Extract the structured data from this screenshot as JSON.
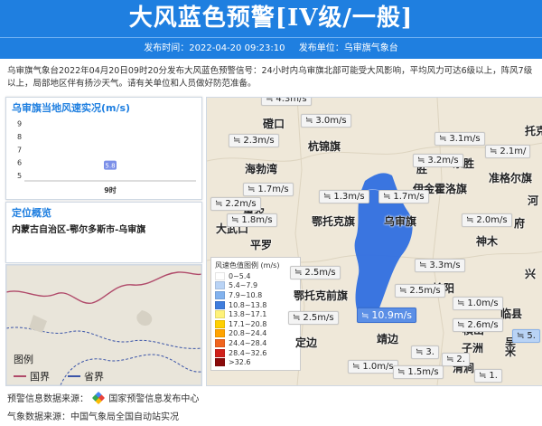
{
  "header": {
    "title": "大风蓝色预警[IV级/一般]",
    "publish_time": "发布时间：2022-04-20 09:23:10",
    "publisher": "发布单位：乌审旗气象台"
  },
  "description": "乌审旗气象台2022年04月20日09时20分发布大风蓝色预警信号：24小时内乌审旗北部可能受大风影响，平均风力可达6级以上，阵风7级以上，局部地区伴有扬沙天气。请有关单位和人员做好防范准备。",
  "wind_panel": {
    "title": "乌审旗当地风速实况(m/s)"
  },
  "chart_data": {
    "type": "bar",
    "categories": [
      "9时"
    ],
    "values": [
      5.8
    ],
    "ylim": [
      4.6,
      9.3
    ],
    "yticks": [
      "9",
      "8",
      "7",
      "6",
      "5"
    ]
  },
  "location": {
    "title": "定位概览",
    "path": "内蒙古自治区-鄂尔多斯市-乌审旗"
  },
  "map_legend": {
    "title": "图例",
    "items": [
      {
        "label": "国界",
        "color": "#b04a6a"
      },
      {
        "label": "省界",
        "color": "#3a54a8"
      }
    ]
  },
  "wind_legend": {
    "title": "风速色值图例 (m/s)",
    "items": [
      {
        "range": "0~5.4",
        "color": "#ffffff"
      },
      {
        "range": "5.4~7.9",
        "color": "#b9d3f5"
      },
      {
        "range": "7.9~10.8",
        "color": "#82b2ee"
      },
      {
        "range": "10.8~13.8",
        "color": "#3f7ddd"
      },
      {
        "range": "13.8~17.1",
        "color": "#fff27a"
      },
      {
        "range": "17.1~20.8",
        "color": "#ffd000"
      },
      {
        "range": "20.8~24.4",
        "color": "#ffa300"
      },
      {
        "range": "24.4~28.4",
        "color": "#f0641e"
      },
      {
        "range": "28.4~32.6",
        "color": "#d0201a"
      },
      {
        "range": ">32.6",
        "color": "#8a0a0a"
      }
    ]
  },
  "map": {
    "places": [
      "磴口",
      "杭锦旗",
      "海勃湾",
      "伊金霍洛旗",
      "准格尔旗",
      "鄂托克旗",
      "乌审旗",
      "大武口",
      "平罗",
      "神木",
      "鄂托克前旗",
      "榆阳",
      "靖边",
      "横山",
      "临县",
      "子洲",
      "清涧",
      "吴",
      "汶",
      "兴",
      "托克",
      "河",
      "府",
      "米",
      "定边",
      "东胜",
      "惠农",
      "胜"
    ],
    "stations": [
      {
        "value": "4.3m/s",
        "type": "normal"
      },
      {
        "value": "3.0m/s",
        "type": "normal"
      },
      {
        "value": "2.3m/s",
        "type": "normal"
      },
      {
        "value": "3.1m/s",
        "type": "normal"
      },
      {
        "value": "2.1m/",
        "type": "normal"
      },
      {
        "value": "3.2m/s",
        "type": "normal"
      },
      {
        "value": "1.7m/s",
        "type": "normal"
      },
      {
        "value": "1.3m/s",
        "type": "normal"
      },
      {
        "value": "1.7m/s",
        "type": "normal"
      },
      {
        "value": "2.2m/s",
        "type": "normal"
      },
      {
        "value": "1.8m/s",
        "type": "normal"
      },
      {
        "value": "2.0m/s",
        "type": "normal"
      },
      {
        "value": "3.3m/s",
        "type": "normal"
      },
      {
        "value": "2.5m/s",
        "type": "normal"
      },
      {
        "value": "2.5m/s",
        "type": "normal"
      },
      {
        "value": "1.0m/s",
        "type": "normal"
      },
      {
        "value": "2.5m/s",
        "type": "normal"
      },
      {
        "value": "10.9m/s",
        "type": "selected"
      },
      {
        "value": "2.6m/s",
        "type": "normal"
      },
      {
        "value": "5.",
        "type": "light"
      },
      {
        "value": "1.0m/s",
        "type": "normal"
      },
      {
        "value": "1.5m/s",
        "type": "normal"
      },
      {
        "value": "3.",
        "type": "normal"
      },
      {
        "value": "2.",
        "type": "normal"
      },
      {
        "value": "1.",
        "type": "normal"
      }
    ]
  },
  "footer": {
    "source_label": "预警信息数据来源：",
    "source_name": "国家预警信息发布中心",
    "weather_label": "气象数据来源：中国气象局全国自动站实况"
  }
}
